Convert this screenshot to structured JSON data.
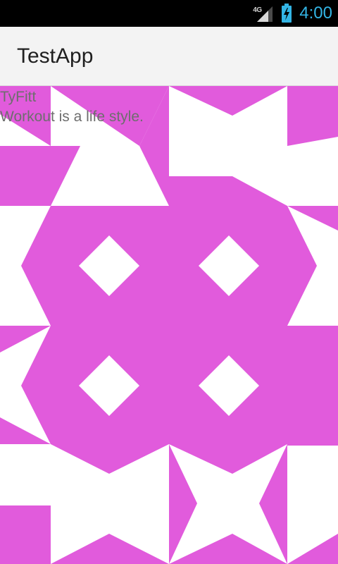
{
  "status_bar": {
    "network": "4G",
    "time": "4:00",
    "signal_icon": "signal-bars-icon",
    "battery_icon": "battery-charging-icon",
    "accent_color": "#33b5e5"
  },
  "action_bar": {
    "title": "TestApp"
  },
  "content": {
    "brand_name": "TyFitt",
    "tagline": "Workout is a life style.",
    "pattern_color": "#e15bdc",
    "pattern_background": "#ffffff"
  }
}
